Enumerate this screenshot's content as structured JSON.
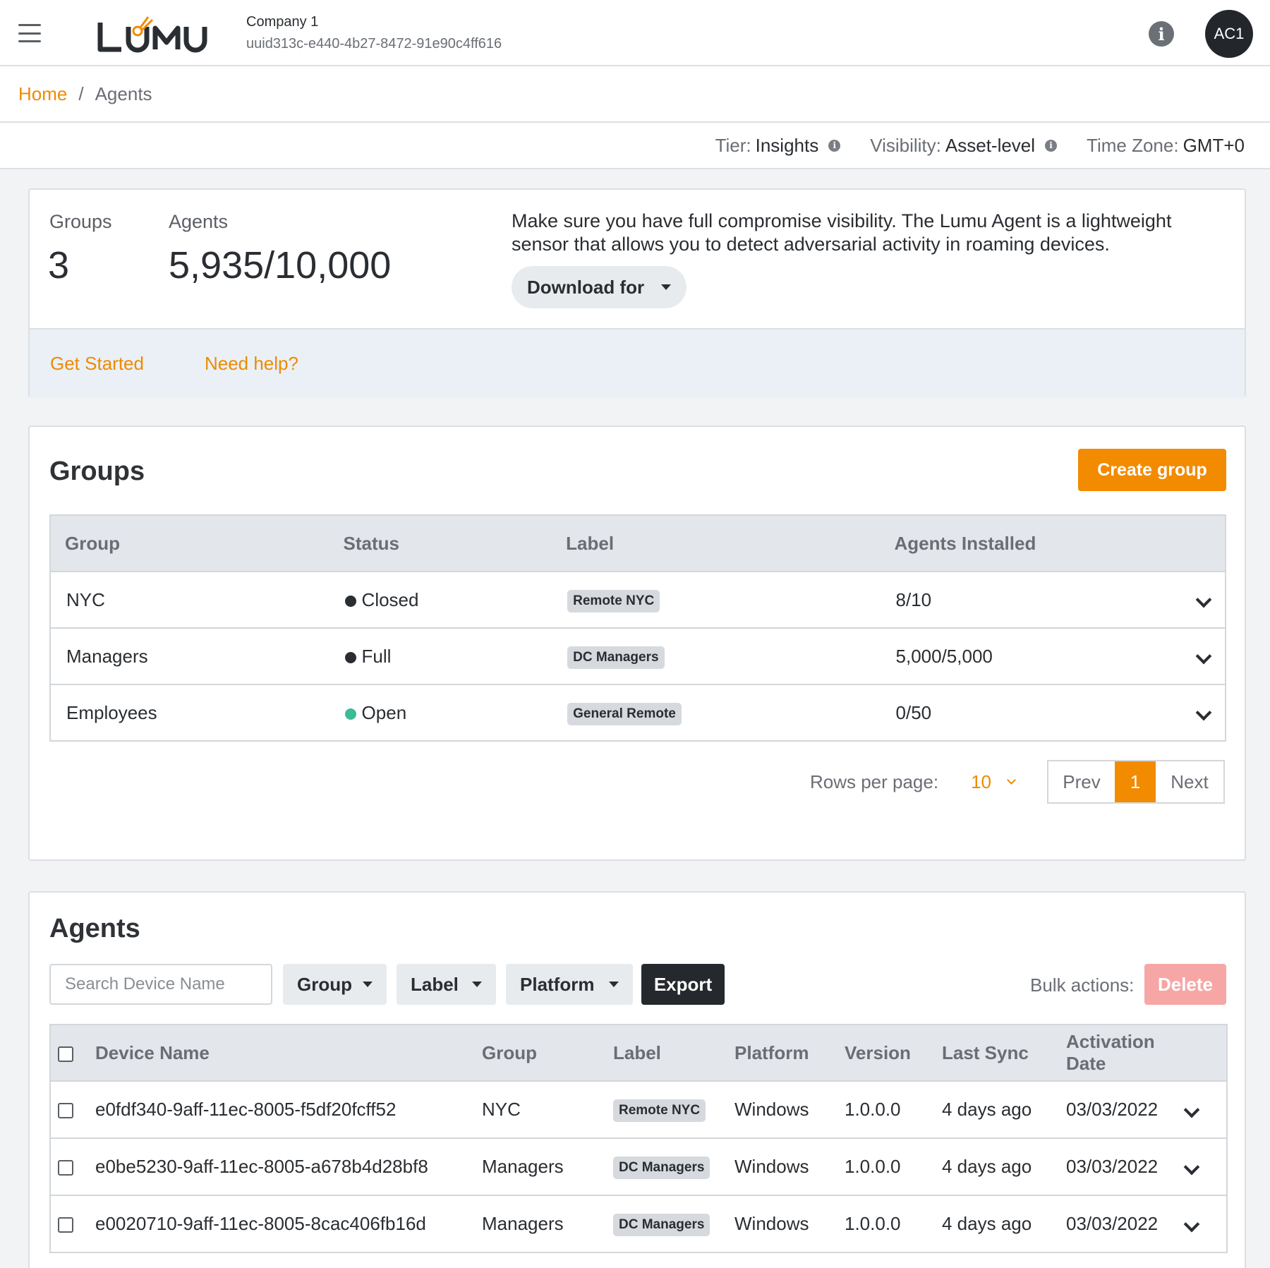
{
  "header": {
    "logo_text": "LUMU",
    "company_name": "Company 1",
    "company_uuid": "uuid313c-e440-4b27-8472-91e90c4ff616",
    "info_icon": "info-icon",
    "avatar_initials": "AC1"
  },
  "breadcrumb": {
    "home": "Home",
    "separator": "/",
    "current": "Agents"
  },
  "meta": {
    "tier_label": "Tier:",
    "tier_value": "Insights",
    "visibility_label": "Visibility:",
    "visibility_value": "Asset-level",
    "timezone_label": "Time Zone:",
    "timezone_value": "GMT+0"
  },
  "summary": {
    "groups_label": "Groups",
    "groups_value": "3",
    "agents_label": "Agents",
    "agents_value": "5,935/10,000",
    "description": "Make sure you have full compromise visibility. The Lumu Agent is a lightweight sensor that allows you to detect adversarial activity in roaming devices.",
    "download_label": "Download for",
    "get_started": "Get Started",
    "need_help": "Need help?"
  },
  "groups": {
    "title": "Groups",
    "create_label": "Create group",
    "columns": [
      "Group",
      "Status",
      "Label",
      "Agents Installed"
    ],
    "rows": [
      {
        "group": "NYC",
        "status": "Closed",
        "status_color": "#2a2d31",
        "label": "Remote NYC",
        "installed": "8/10"
      },
      {
        "group": "Managers",
        "status": "Full",
        "status_color": "#2a2d31",
        "label": "DC Managers",
        "installed": "5,000/5,000"
      },
      {
        "group": "Employees",
        "status": "Open",
        "status_color": "#3dbb95",
        "label": "General Remote",
        "installed": "0/50"
      }
    ],
    "rows_per_page_label": "Rows per page:",
    "rows_per_page_value": "10",
    "prev": "Prev",
    "page": "1",
    "next": "Next"
  },
  "agents": {
    "title": "Agents",
    "search_placeholder": "Search Device Name",
    "filter_group": "Group",
    "filter_label": "Label",
    "filter_platform": "Platform",
    "export_label": "Export",
    "bulk_label": "Bulk actions:",
    "delete_label": "Delete",
    "columns": [
      "Device Name",
      "Group",
      "Label",
      "Platform",
      "Version",
      "Last Sync",
      "Activation Date"
    ],
    "rows": [
      {
        "device": "e0fdf340-9aff-11ec-8005-f5df20fcff52",
        "group": "NYC",
        "label": "Remote NYC",
        "platform": "Windows",
        "version": "1.0.0.0",
        "last_sync": "4 days ago",
        "activation": "03/03/2022"
      },
      {
        "device": "e0be5230-9aff-11ec-8005-a678b4d28bf8",
        "group": "Managers",
        "label": "DC Managers",
        "platform": "Windows",
        "version": "1.0.0.0",
        "last_sync": "4 days ago",
        "activation": "03/03/2022"
      },
      {
        "device": "e0020710-9aff-11ec-8005-8cac406fb16d",
        "group": "Managers",
        "label": "DC Managers",
        "platform": "Windows",
        "version": "1.0.0.0",
        "last_sync": "4 days ago",
        "activation": "03/03/2022"
      }
    ]
  },
  "colors": {
    "accent": "#f28b00",
    "link": "#ed8b00",
    "danger_disabled": "#f7a6a6",
    "dark": "#25292d"
  }
}
